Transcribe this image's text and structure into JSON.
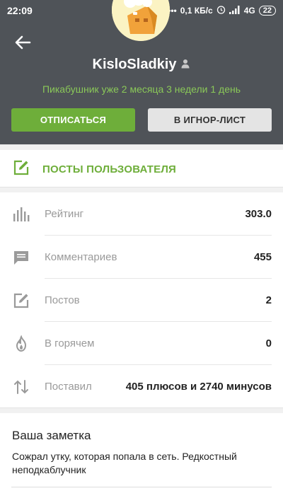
{
  "status_bar": {
    "time": "22:09",
    "network_speed": "0,1 КБ/с",
    "network_type": "4G",
    "battery": "22"
  },
  "profile": {
    "username": "KisloSladkiy",
    "since": "Пикабушник уже 2 месяца 3 недели 1 день",
    "unsubscribe_label": "ОТПИСАТЬСЯ",
    "ignore_label": "В ИГНОР-ЛИСТ"
  },
  "posts_link": {
    "label": "ПОСТЫ ПОЛЬЗОВАТЕЛЯ"
  },
  "stats": [
    {
      "name": "Рейтинг",
      "value": "303.0",
      "icon": "rating-bars-icon"
    },
    {
      "name": "Комментариев",
      "value": "455",
      "icon": "comment-icon"
    },
    {
      "name": "Постов",
      "value": "2",
      "icon": "edit-icon"
    },
    {
      "name": "В горячем",
      "value": "0",
      "icon": "flame-icon"
    },
    {
      "name": "Поставил",
      "value": "405 плюсов и 2740 минусов",
      "icon": "up-down-arrows-icon"
    }
  ],
  "note": {
    "title": "Ваша заметка",
    "text": "Сожрал утку,  которая попала в сеть. Редкостный неподкаблучник"
  },
  "colors": {
    "header_bg": "#4f5358",
    "accent_green": "#6eae3a",
    "since_green": "#8ac858",
    "ignore_bg": "#e4e4e4"
  }
}
